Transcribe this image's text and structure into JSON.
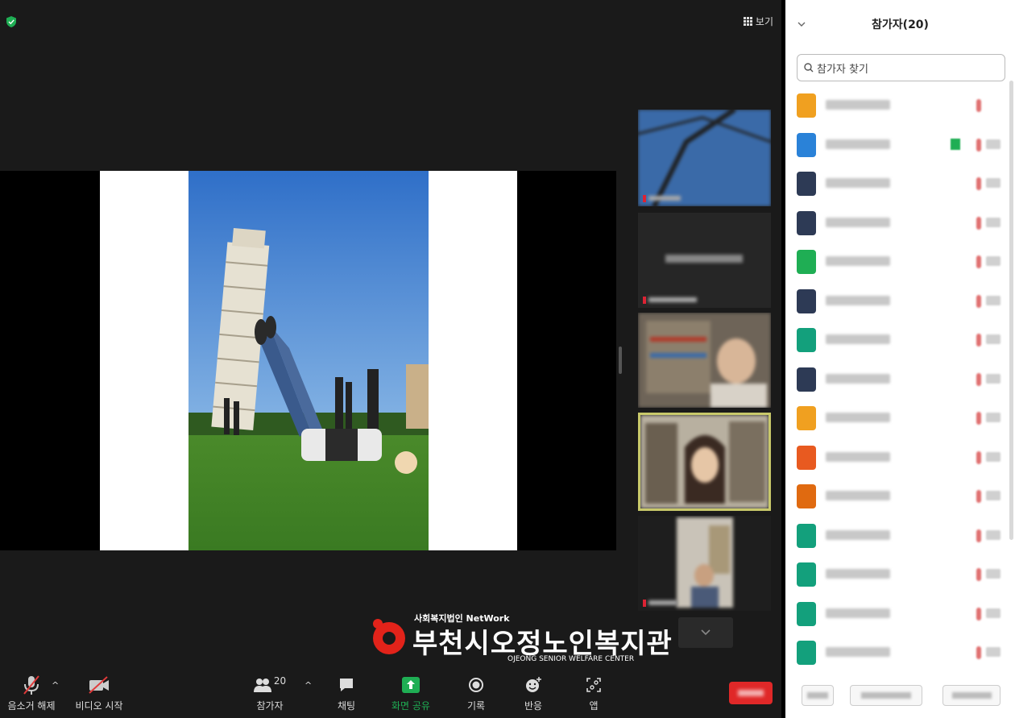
{
  "meeting": {
    "view_label": "보기"
  },
  "branding": {
    "org_small": "사회복지법인 NetWork",
    "org_name": "부천시오정노인복지관",
    "org_eng": "OJEONG SENIOR WELFARE CENTER"
  },
  "toolbar": {
    "unmute_label": "음소거 해제",
    "video_label": "비디오 시작",
    "participants_label": "참가자",
    "participants_count": "20",
    "chat_label": "채팅",
    "share_label": "화면 공유",
    "record_label": "기록",
    "reactions_label": "반응",
    "apps_label": "앱"
  },
  "panel": {
    "title": "참가자(20)",
    "search_placeholder": "참가자 찾기",
    "participants": [
      {
        "color": "#f0a020",
        "green": false
      },
      {
        "color": "#2a82d8",
        "green": true
      },
      {
        "color": "#2d3a55",
        "green": false
      },
      {
        "color": "#2d3a55",
        "green": false
      },
      {
        "color": "#1fae54",
        "green": false
      },
      {
        "color": "#2d3a55",
        "green": false
      },
      {
        "color": "#13a07c",
        "green": false
      },
      {
        "color": "#2d3a55",
        "green": false
      },
      {
        "color": "#f0a020",
        "green": false
      },
      {
        "color": "#e85a20",
        "green": false
      },
      {
        "color": "#e06a10",
        "green": false
      },
      {
        "color": "#13a07c",
        "green": false
      },
      {
        "color": "#13a07c",
        "green": false
      },
      {
        "color": "#13a07c",
        "green": false
      },
      {
        "color": "#13a07c",
        "green": false
      }
    ]
  },
  "colors": {
    "accent_green": "#1fae54",
    "end_red": "#e02828",
    "active_speaker": "#c8c86a"
  }
}
